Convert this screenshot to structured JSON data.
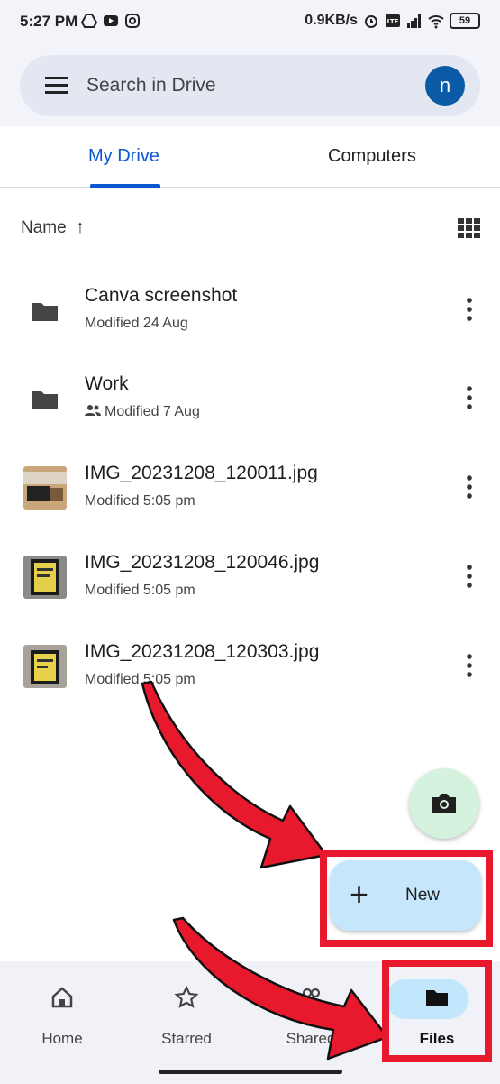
{
  "status_bar": {
    "time": "5:27 PM",
    "net_speed": "0.9KB/s",
    "battery": "59",
    "icons": [
      "drive-icon",
      "youtube-icon",
      "instagram-icon",
      "alarm-icon",
      "volte-icon",
      "signal-icon",
      "wifi-icon",
      "battery-icon"
    ]
  },
  "search": {
    "placeholder": "Search in Drive",
    "avatar_letter": "n"
  },
  "tabs": [
    {
      "label": "My Drive",
      "active": true
    },
    {
      "label": "Computers",
      "active": false
    }
  ],
  "sort": {
    "label": "Name",
    "arrow": "↑"
  },
  "files": [
    {
      "name": "Canva screenshot",
      "meta": "Modified 24 Aug",
      "type": "folder",
      "shared": false
    },
    {
      "name": "Work",
      "meta": "Modified 7 Aug",
      "type": "folder",
      "shared": true
    },
    {
      "name": "IMG_20231208_120011.jpg",
      "meta": "Modified 5:05 pm",
      "type": "image",
      "shared": false
    },
    {
      "name": "IMG_20231208_120046.jpg",
      "meta": "Modified 5:05 pm",
      "type": "image",
      "shared": false
    },
    {
      "name": "IMG_20231208_120303.jpg",
      "meta": "Modified 5:05 pm",
      "type": "image",
      "shared": false
    }
  ],
  "fab": {
    "new_label": "New",
    "new_plus": "+"
  },
  "bottom_nav": [
    {
      "label": "Home",
      "icon": "home-icon",
      "active": false
    },
    {
      "label": "Starred",
      "icon": "star-icon",
      "active": false
    },
    {
      "label": "Shared",
      "icon": "shared-icon",
      "active": false
    },
    {
      "label": "Files",
      "icon": "folder-icon",
      "active": true
    }
  ],
  "colors": {
    "accent": "#0b57d0",
    "highlight_red": "#e8192c",
    "new_fab": "#c6e6fb",
    "camera_fab": "#d4f2de"
  }
}
